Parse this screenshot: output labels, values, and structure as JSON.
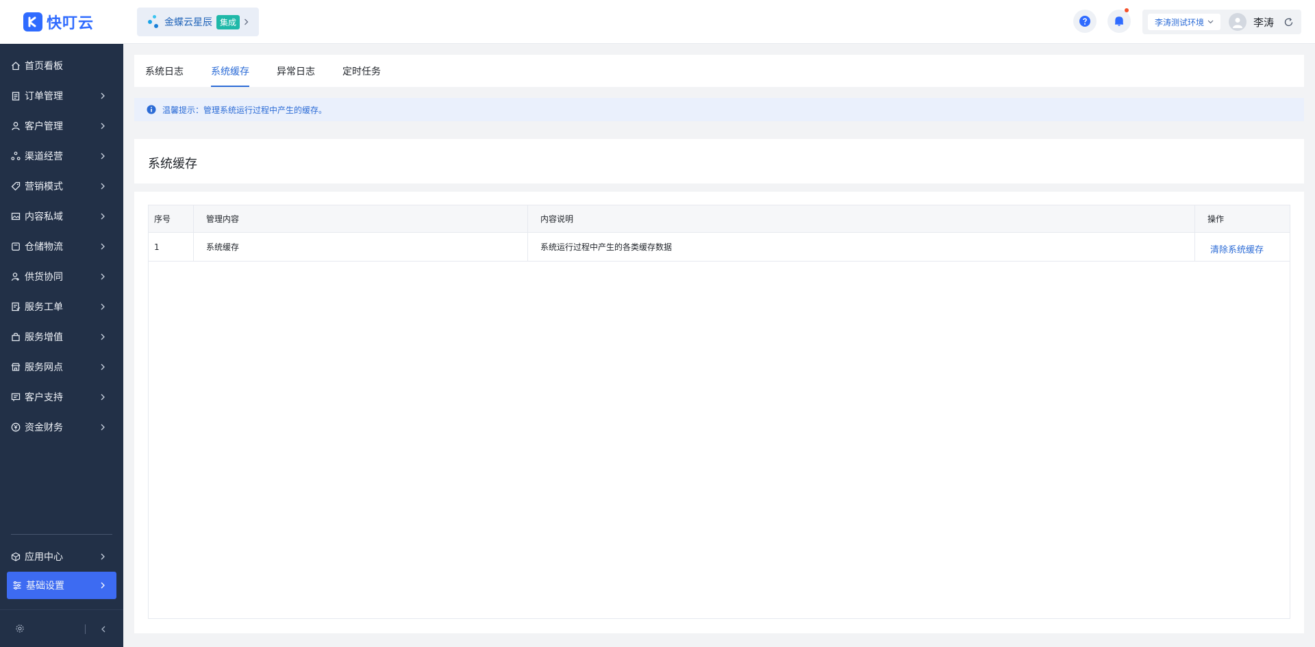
{
  "brand": {
    "name": "快叮云",
    "color": "#2f6bff"
  },
  "sidebar": {
    "items": [
      {
        "label": "首页看板",
        "icon": "home-icon",
        "has_children": false
      },
      {
        "label": "订单管理",
        "icon": "clipboard-icon",
        "has_children": true
      },
      {
        "label": "客户管理",
        "icon": "user-icon",
        "has_children": true
      },
      {
        "label": "渠道经营",
        "icon": "channel-icon",
        "has_children": true
      },
      {
        "label": "营销模式",
        "icon": "tag-icon",
        "has_children": true
      },
      {
        "label": "内容私域",
        "icon": "image-icon",
        "has_children": true
      },
      {
        "label": "仓储物流",
        "icon": "box-icon",
        "has_children": true
      },
      {
        "label": "供货协同",
        "icon": "supplier-icon",
        "has_children": true
      },
      {
        "label": "服务工单",
        "icon": "ticket-icon",
        "has_children": true
      },
      {
        "label": "服务增值",
        "icon": "bag-icon",
        "has_children": true
      },
      {
        "label": "服务网点",
        "icon": "store-icon",
        "has_children": true
      },
      {
        "label": "客户支持",
        "icon": "support-icon",
        "has_children": true
      },
      {
        "label": "资金财务",
        "icon": "yen-icon",
        "has_children": true
      }
    ],
    "bottom_items": [
      {
        "label": "应用中心",
        "icon": "cube-icon",
        "active": false
      },
      {
        "label": "基础设置",
        "icon": "sliders-icon",
        "active": true
      }
    ],
    "active_color": "#3d6bf2",
    "background": "#223047"
  },
  "header": {
    "app_name": "金蝶云星辰",
    "app_badge": "集成",
    "environment": "李涛测试环境",
    "user_name": "李涛",
    "notification_dot_color": "#f5512b"
  },
  "tabs": [
    {
      "label": "系统日志",
      "active": false
    },
    {
      "label": "系统缓存",
      "active": true
    },
    {
      "label": "异常日志",
      "active": false
    },
    {
      "label": "定时任务",
      "active": false
    }
  ],
  "notice": {
    "text": "温馨提示：管理系统运行过程中产生的缓存。"
  },
  "page_title": "系统缓存",
  "table": {
    "columns": [
      "序号",
      "管理内容",
      "内容说明",
      "操作"
    ],
    "rows": [
      {
        "index": "1",
        "content": "系统缓存",
        "description": "系统运行过程中产生的各类缓存数据",
        "action": "清除系统缓存"
      }
    ]
  },
  "accent_color": "#2b6bd6"
}
